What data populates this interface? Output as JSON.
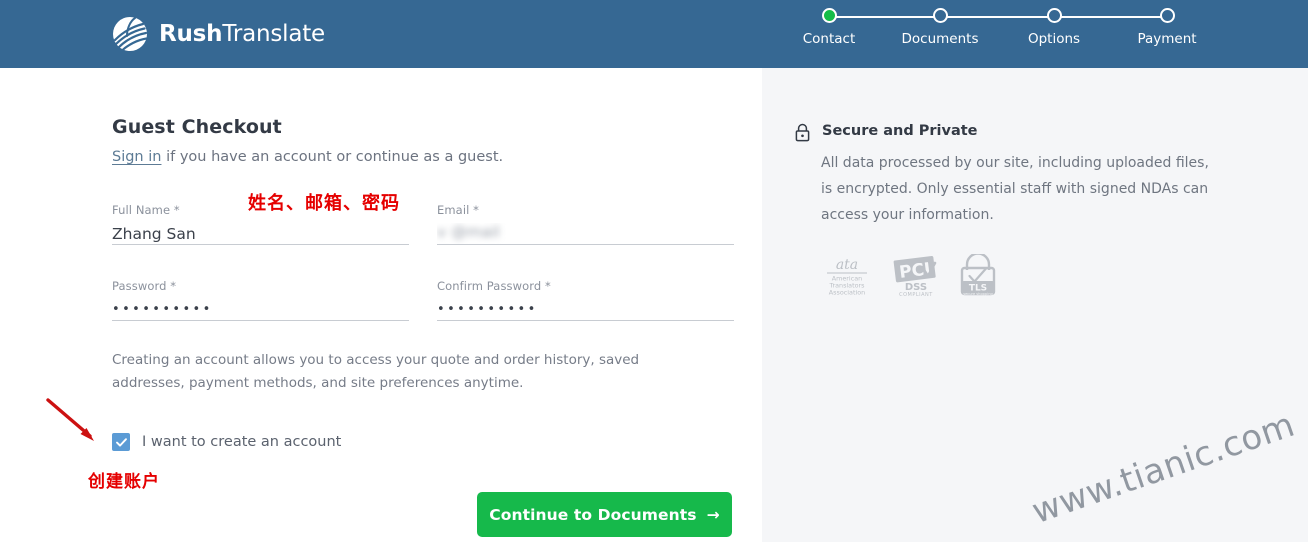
{
  "brand": {
    "name_bold": "Rush",
    "name_light": "Translate",
    "logo_icon": "globe-swoosh-icon",
    "header_color": "#366893"
  },
  "stepper": {
    "current_index": 0,
    "active_color": "#14bd48",
    "steps": [
      {
        "label": "Contact",
        "state": "done"
      },
      {
        "label": "Documents",
        "state": "todo"
      },
      {
        "label": "Options",
        "state": "todo"
      },
      {
        "label": "Payment",
        "state": "todo"
      }
    ]
  },
  "main": {
    "title": "Guest Checkout",
    "subline_link": "Sign in",
    "subline_rest": " if you have an account or continue as a guest.",
    "fields": {
      "full_name": {
        "label": "Full Name *",
        "value": "Zhang San"
      },
      "email": {
        "label": "Email *",
        "value": "v     @mail  ",
        "redacted": true
      },
      "password": {
        "label": "Password *",
        "value": "••••••••••"
      },
      "confirm_password": {
        "label": "Confirm Password *",
        "value": "••••••••••"
      }
    },
    "account_note": "Creating an account allows you to access your quote and order history, saved addresses, payment methods, and site preferences anytime.",
    "checkbox": {
      "label": "I want to create an account",
      "checked": true,
      "color": "#5b9bd5"
    },
    "continue_button": {
      "label": "Continue to Documents",
      "arrow": "→",
      "color": "#16b94b"
    }
  },
  "sidebar": {
    "lock_icon": "lock-icon",
    "title": "Secure and Private",
    "body": "All data processed by our site, including uploaded files, is encrypted. Only essential staff with signed NDAs can access your information.",
    "badges": [
      {
        "name": "ata-badge",
        "line1": "ata",
        "line2": "American",
        "line3": "Translators",
        "line4": "Association"
      },
      {
        "name": "pci-dss-badge",
        "line1": "PCI",
        "line2": "DSS",
        "line3": "COMPLIANT",
        "line4": ""
      },
      {
        "name": "tls-badge",
        "line1": "TLS",
        "line2": "secure shopping",
        "line3": "",
        "line4": ""
      }
    ]
  },
  "annotations": {
    "fields_note": "姓名、邮箱、密码",
    "create_account_note": "创建账户",
    "color": "#e50000",
    "arrow": "red-arrow-pointing-to-checkbox"
  },
  "watermark": {
    "text": "www.tianic.com"
  }
}
